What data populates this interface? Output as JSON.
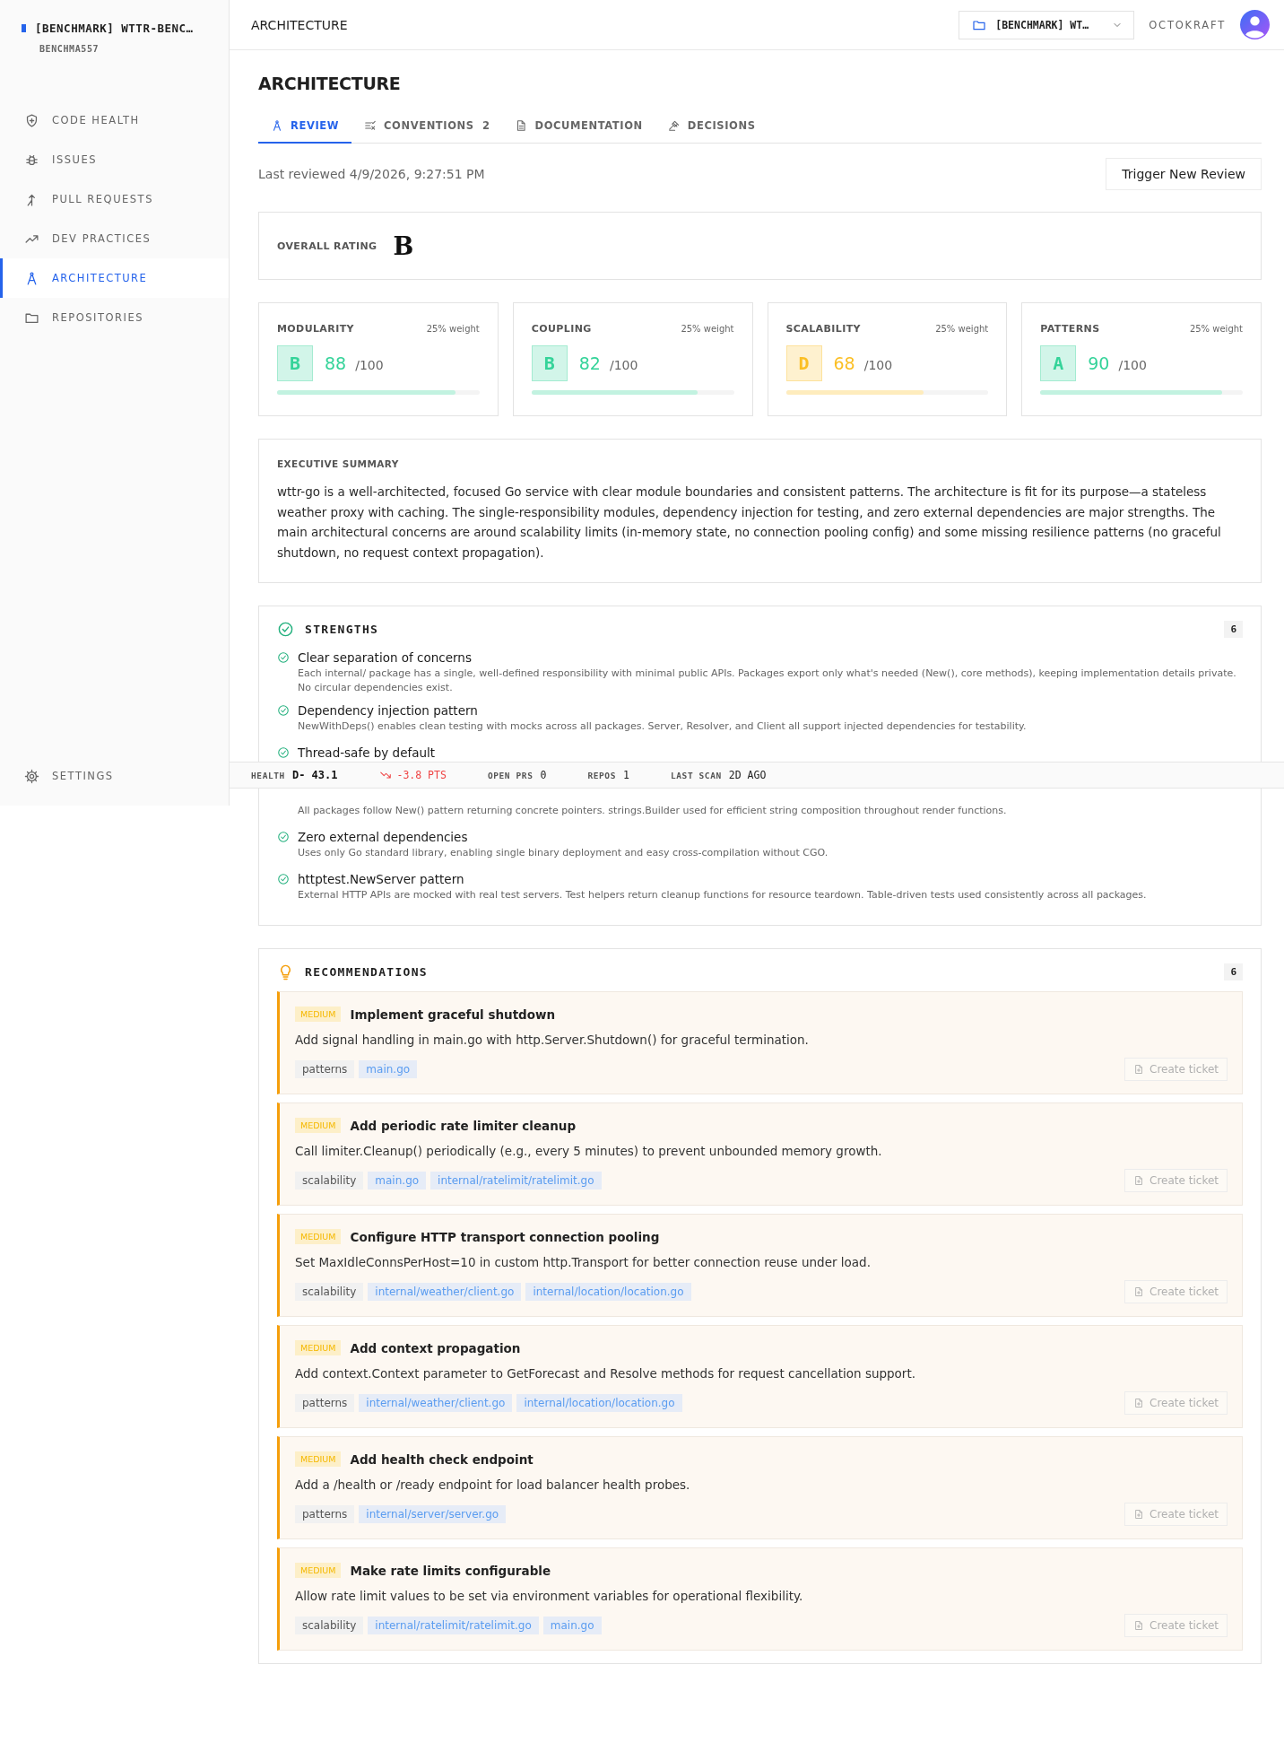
{
  "sidebar": {
    "brand": "[BENCHMARK] WTTR-BENC…",
    "org": "BENCHMA557",
    "items": [
      {
        "label": "CODE HEALTH",
        "kind": "shield",
        "selected": false
      },
      {
        "label": "ISSUES",
        "kind": "bug",
        "selected": false
      },
      {
        "label": "PULL REQUESTS",
        "kind": "merge",
        "selected": false
      },
      {
        "label": "DEV PRACTICES",
        "kind": "trend",
        "selected": false
      },
      {
        "label": "ARCHITECTURE",
        "kind": "compass",
        "selected": true
      },
      {
        "label": "REPOSITORIES",
        "kind": "folder",
        "selected": false
      }
    ],
    "settings": "SETTINGS"
  },
  "header": {
    "breadcrumb": "ARCHITECTURE",
    "repo_selector": "[BENCHMARK] WT…",
    "user": "OCTOKRAFT"
  },
  "page_title": "ARCHITECTURE",
  "tabs": [
    {
      "label": "REVIEW",
      "kind": "compass",
      "selected": true
    },
    {
      "label": "CONVENTIONS",
      "kind": "listcheck",
      "count": "2",
      "selected": false
    },
    {
      "label": "DOCUMENTATION",
      "kind": "file",
      "selected": false
    },
    {
      "label": "DECISIONS",
      "kind": "gavel",
      "selected": false
    }
  ],
  "last_reviewed": "Last reviewed 4/9/2026, 9:27:51 PM",
  "trigger_button": "Trigger New Review",
  "overall": {
    "label": "OVERALL RATING",
    "grade": "B"
  },
  "cards": [
    {
      "name": "MODULARITY",
      "weight": "25% weight",
      "grade": "B",
      "score": "88",
      "max": "/100",
      "level": 0.88,
      "color": "#34d399"
    },
    {
      "name": "COUPLING",
      "weight": "25% weight",
      "grade": "B",
      "score": "82",
      "max": "/100",
      "level": 0.82,
      "color": "#34d399"
    },
    {
      "name": "SCALABILITY",
      "weight": "25% weight",
      "grade": "D",
      "score": "68",
      "max": "/100",
      "level": 0.68,
      "color": "#fbbf24"
    },
    {
      "name": "PATTERNS",
      "weight": "25% weight",
      "grade": "A",
      "score": "90",
      "max": "/100",
      "level": 0.9,
      "color": "#34d399"
    }
  ],
  "summary": {
    "label": "EXECUTIVE SUMMARY",
    "text": "wttr-go is a well-architected, focused Go service with clear module boundaries and consistent patterns. The architecture is fit for its purpose—a stateless weather proxy with caching. The single-responsibility modules, dependency injection for testing, and zero external dependencies are major strengths. The main architectural concerns are around scalability limits (in-memory state, no connection pooling config) and some missing resilience patterns (no graceful shutdown, no request context propagation)."
  },
  "strengths": {
    "title": "STRENGTHS",
    "count": "6",
    "items": [
      {
        "title": "Clear separation of concerns",
        "description": "Each internal/ package has a single, well-defined responsibility with minimal public APIs. Packages export only what's needed (New(), core methods), keeping implementation details private. No circular dependencies exist."
      },
      {
        "title": "Dependency injection pattern",
        "description": "NewWithDeps() enables clean testing with mocks across all packages. Server, Resolver, and Client all support injected dependencies for testability."
      },
      {
        "title": "Thread-safe by default"
      },
      {
        "description": "All packages follow New() pattern returning concrete pointers. strings.Builder used for efficient string composition throughout render functions."
      },
      {
        "title": "Zero external dependencies",
        "description": "Uses only Go standard library, enabling single binary deployment and easy cross-compilation without CGO."
      },
      {
        "title": "httptest.NewServer pattern",
        "description": "External HTTP APIs are mocked with real test servers. Test helpers return cleanup functions for resource teardown. Table-driven tests used consistently across all packages."
      }
    ]
  },
  "recommendations": {
    "title": "RECOMMENDATIONS",
    "count": "6",
    "items": [
      {
        "priority": "MEDIUM",
        "title": "Implement graceful shutdown",
        "description": "Add signal handling in main.go with http.Server.Shutdown() for graceful termination.",
        "category": "patterns",
        "files": [
          "main.go"
        ],
        "button": "Create ticket",
        "button_disabled": true
      },
      {
        "priority": "MEDIUM",
        "title": "Add periodic rate limiter cleanup",
        "description": "Call limiter.Cleanup() periodically (e.g., every 5 minutes) to prevent unbounded memory growth.",
        "category": "scalability",
        "files": [
          "main.go",
          "internal/ratelimit/ratelimit.go"
        ],
        "button": "Create ticket",
        "button_disabled": true
      },
      {
        "priority": "MEDIUM",
        "title": "Configure HTTP transport connection pooling",
        "description": "Set MaxIdleConnsPerHost=10 in custom http.Transport for better connection reuse under load.",
        "category": "scalability",
        "files": [
          "internal/weather/client.go",
          "internal/location/location.go"
        ],
        "button": "Create ticket",
        "button_disabled": true
      },
      {
        "priority": "MEDIUM",
        "title": "Add context propagation",
        "description": "Add context.Context parameter to GetForecast and Resolve methods for request cancellation support.",
        "category": "patterns",
        "files": [
          "internal/weather/client.go",
          "internal/location/location.go"
        ],
        "button": "Create ticket",
        "button_disabled": true
      },
      {
        "priority": "MEDIUM",
        "title": "Add health check endpoint",
        "description": "Add a /health or /ready endpoint for load balancer health probes.",
        "category": "patterns",
        "files": [
          "internal/server/server.go"
        ],
        "button": "Create ticket",
        "button_disabled": true
      },
      {
        "priority": "MEDIUM",
        "title": "Make rate limits configurable",
        "description": "Allow rate limit values to be set via environment variables for operational flexibility.",
        "category": "scalability",
        "files": [
          "internal/ratelimit/ratelimit.go",
          "main.go"
        ],
        "button": "Create ticket",
        "button_disabled": true
      }
    ]
  },
  "status_bar": {
    "health_label": "HEALTH",
    "health": "D- 43.1",
    "trend": "-3.8 PTS",
    "prs_label": "OPEN PRS",
    "prs": "0",
    "repos_label": "REPOS",
    "repos": "1",
    "scan_label": "LAST SCAN",
    "scan": "2D AGO"
  }
}
